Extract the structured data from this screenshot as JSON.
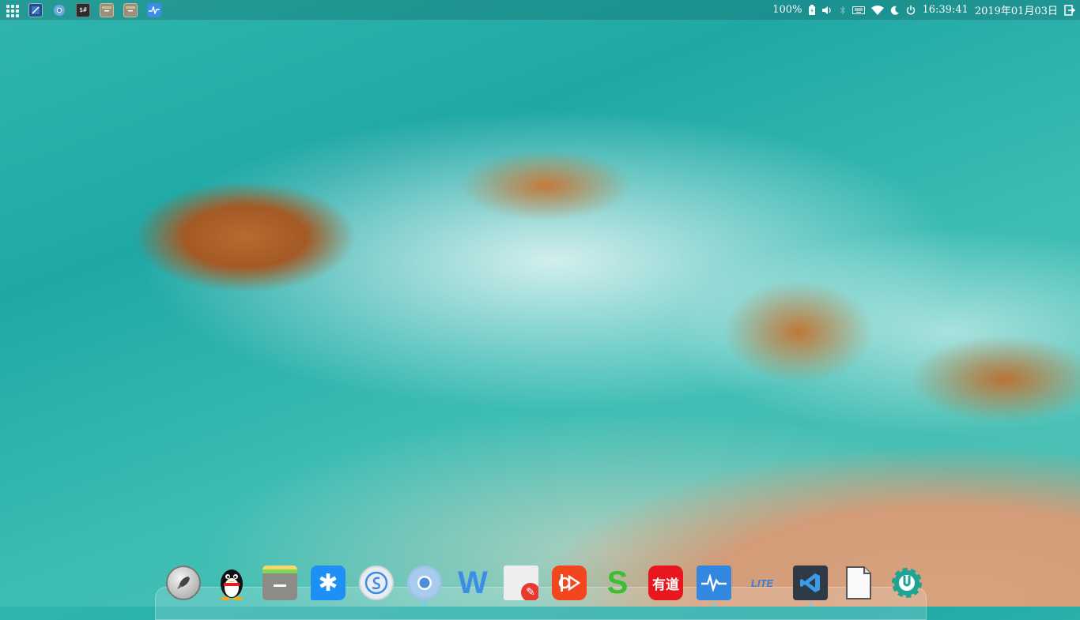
{
  "top_panel": {
    "launcher_icon": "grid-9-dots-icon",
    "task_icons": [
      {
        "name": "deepin-screenshot-icon",
        "label": ""
      },
      {
        "name": "chrome-icon",
        "label": ""
      },
      {
        "name": "terminal-icon",
        "label": "$#"
      },
      {
        "name": "file-manager-icon",
        "label": ""
      },
      {
        "name": "file-manager-icon-2",
        "label": ""
      },
      {
        "name": "system-monitor-icon",
        "label": ""
      }
    ],
    "tray": {
      "battery_percent": "100%",
      "clock": "16:39:41",
      "date": "2019年01月03日",
      "icons": [
        "battery-icon",
        "volume-icon",
        "bluetooth-icon",
        "keyboard-icon",
        "wifi-icon",
        "night-mode-icon",
        "power-icon",
        "logout-icon"
      ]
    }
  },
  "dock": {
    "items": [
      {
        "name": "launcher-rocket",
        "icon": "rocket-icon"
      },
      {
        "name": "qq",
        "icon": "penguin-icon"
      },
      {
        "name": "file-manager",
        "icon": "folder-icon"
      },
      {
        "name": "dingtalk",
        "icon": "star-bubble-icon"
      },
      {
        "name": "sogou",
        "icon": "s-circle-icon"
      },
      {
        "name": "chrome",
        "icon": "chrome-icon"
      },
      {
        "name": "wps-writer",
        "icon": "w-icon",
        "label": "W"
      },
      {
        "name": "text-editor",
        "icon": "note-edit-icon"
      },
      {
        "name": "video-player",
        "icon": "play-icon"
      },
      {
        "name": "wps-spreadsheet",
        "icon": "s-icon",
        "label": "S"
      },
      {
        "name": "youdao-dict",
        "icon": "youdao-icon",
        "label": "有道"
      },
      {
        "name": "system-monitor",
        "icon": "pulse-icon"
      },
      {
        "name": "lite-app",
        "icon": "lite-icon",
        "label": "LITE"
      },
      {
        "name": "vscode",
        "icon": "vscode-icon"
      },
      {
        "name": "blank-document",
        "icon": "document-icon"
      },
      {
        "name": "settings-tool",
        "icon": "gear-wrench-icon"
      }
    ]
  }
}
